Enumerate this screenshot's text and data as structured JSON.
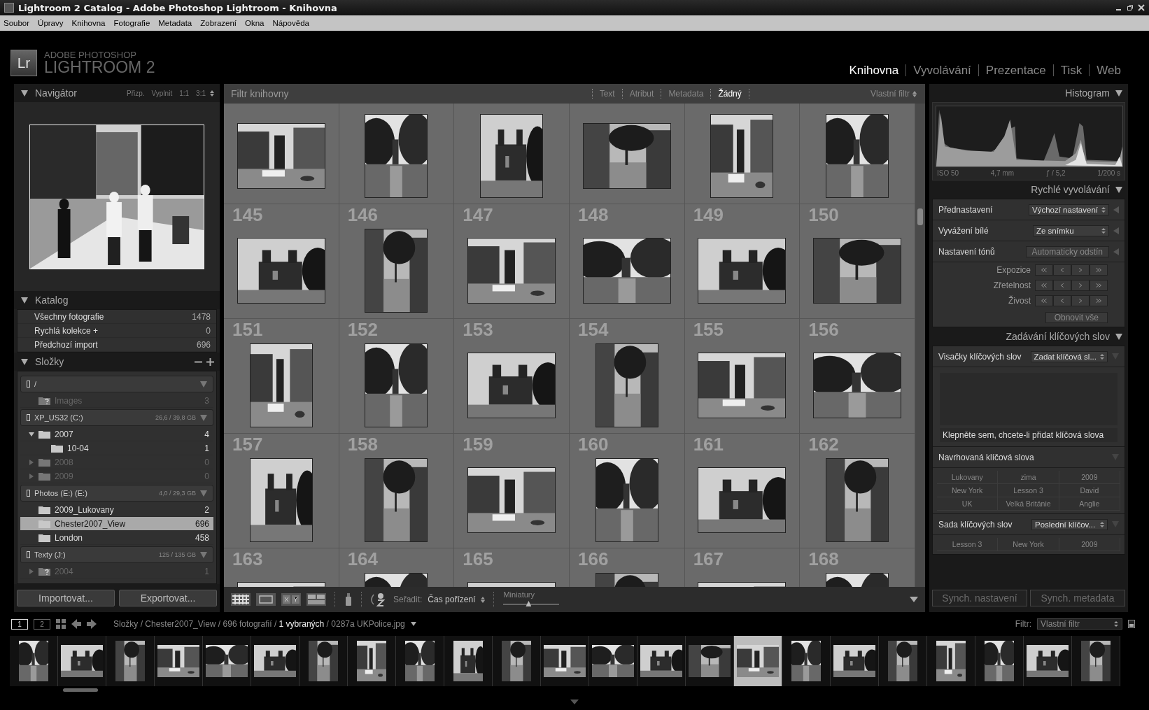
{
  "window": {
    "title": "Lightroom 2 Catalog - Adobe Photoshop Lightroom - Knihovna"
  },
  "menu": [
    "Soubor",
    "Úpravy",
    "Knihovna",
    "Fotografie",
    "Metadata",
    "Zobrazení",
    "Okna",
    "Nápověda"
  ],
  "brand": {
    "logo": "Lr",
    "line1": "ADOBE PHOTOSHOP",
    "line2": "LIGHTROOM 2"
  },
  "modules": [
    {
      "label": "Knihovna",
      "selected": true
    },
    {
      "label": "Vyvolávání",
      "selected": false
    },
    {
      "label": "Prezentace",
      "selected": false
    },
    {
      "label": "Tisk",
      "selected": false
    },
    {
      "label": "Web",
      "selected": false
    }
  ],
  "navigator": {
    "title": "Navigátor",
    "zoom_options": [
      "Přizp.",
      "Vyplnit",
      "1:1",
      "3:1"
    ]
  },
  "catalog": {
    "title": "Katalog",
    "items": [
      {
        "label": "Všechny fotografie",
        "count": "1478"
      },
      {
        "label": "Rychlá kolekce +",
        "count": "0"
      },
      {
        "label": "Předchozí import",
        "count": "696"
      }
    ]
  },
  "folders": {
    "title": "Složky",
    "volumes": [
      {
        "name": "/",
        "folders": [
          {
            "name": "Images",
            "count": "3",
            "available": false,
            "missing": true,
            "selected": false
          }
        ]
      },
      {
        "name": "XP_US32 (C:)",
        "usage": "26,6 / 39,8 GB",
        "folders": [
          {
            "name": "2007",
            "count": "4",
            "available": true,
            "missing": false,
            "selected": false,
            "expanded": true,
            "children": [
              {
                "name": "10-04",
                "count": "1",
                "available": true,
                "missing": false,
                "selected": false
              }
            ]
          },
          {
            "name": "2008",
            "count": "0",
            "available": false,
            "missing": false,
            "selected": false,
            "expanded": false
          },
          {
            "name": "2009",
            "count": "0",
            "available": false,
            "missing": false,
            "selected": false,
            "expanded": false
          }
        ]
      },
      {
        "name": "Photos (E:) (E:)",
        "usage": "4,0 / 29,3 GB",
        "folders": [
          {
            "name": "2009_Lukovany",
            "count": "2",
            "available": true,
            "missing": false,
            "selected": false
          },
          {
            "name": "Chester2007_View",
            "count": "696",
            "available": true,
            "missing": false,
            "selected": true
          },
          {
            "name": "London",
            "count": "458",
            "available": true,
            "missing": false,
            "selected": false
          }
        ]
      },
      {
        "name": "Texty (J:)",
        "usage": "125 / 135 GB",
        "folders": [
          {
            "name": "2004",
            "count": "1",
            "available": false,
            "missing": true,
            "selected": false,
            "expanded": false
          }
        ]
      }
    ]
  },
  "left_buttons": [
    "Importovat...",
    "Exportovat..."
  ],
  "filter_bar": {
    "title": "Filtr knihovny",
    "options": [
      {
        "label": "Text",
        "selected": false
      },
      {
        "label": "Atribut",
        "selected": false
      },
      {
        "label": "Metadata",
        "selected": false
      },
      {
        "label": "Žádný",
        "selected": true
      }
    ],
    "preset": "Vlastní filtr"
  },
  "grid": [
    {
      "portrait": false
    },
    {
      "portrait": true
    },
    {
      "portrait": true
    },
    {
      "portrait": false
    },
    {
      "portrait": true
    },
    {
      "portrait": true
    },
    {
      "number": "145",
      "portrait": false
    },
    {
      "number": "146",
      "portrait": true
    },
    {
      "number": "147",
      "portrait": false
    },
    {
      "number": "148",
      "portrait": false
    },
    {
      "number": "149",
      "portrait": false
    },
    {
      "number": "150",
      "portrait": false
    },
    {
      "number": "151",
      "portrait": true
    },
    {
      "number": "152",
      "portrait": true
    },
    {
      "number": "153",
      "portrait": false
    },
    {
      "number": "154",
      "portrait": true
    },
    {
      "number": "155",
      "portrait": false
    },
    {
      "number": "156",
      "portrait": false
    },
    {
      "number": "157",
      "portrait": true
    },
    {
      "number": "158",
      "portrait": true
    },
    {
      "number": "159",
      "portrait": false
    },
    {
      "number": "160",
      "portrait": true
    },
    {
      "number": "161",
      "portrait": false
    },
    {
      "number": "162",
      "portrait": true
    },
    {
      "number": "163",
      "portrait": false
    },
    {
      "number": "164",
      "portrait": true
    },
    {
      "number": "165",
      "portrait": false
    },
    {
      "number": "166",
      "portrait": true
    },
    {
      "number": "167",
      "portrait": false
    },
    {
      "number": "168",
      "portrait": true
    }
  ],
  "toolbar": {
    "sort_label": "Seřadit:",
    "sort_value": "Čas pořízení",
    "thumb_label": "Miniatury",
    "level": 0.45
  },
  "histogram": {
    "title": "Histogram",
    "exif": [
      "ISO 50",
      "4,7 mm",
      "ƒ / 5,2",
      "1/200 s"
    ]
  },
  "quick_develop": {
    "title": "Rychlé vyvolávání",
    "rows": [
      {
        "kind": "select",
        "label": "Přednastavení",
        "value": "Výchozí nastavení"
      },
      {
        "kind": "select",
        "label": "Vyvážení bílé",
        "value": "Ze snímku"
      },
      {
        "kind": "button",
        "label": "Nastavení tónů",
        "value": "Automaticky odstín"
      },
      {
        "kind": "stepper",
        "label": "Expozice"
      },
      {
        "kind": "stepper",
        "label": "Zřetelnost"
      },
      {
        "kind": "stepper",
        "label": "Živost"
      }
    ],
    "reset": "Obnovit vše"
  },
  "keywording": {
    "title": "Zadávání klíčových slov",
    "tags_label": "Visačky klíčových slov",
    "tags_select": "Zadat klíčová sl...",
    "placeholder": "Klepněte sem, chcete-li přidat klíčová slova",
    "suggested_title": "Navrhovaná klíčová slova",
    "suggested": [
      "Lukovany",
      "zima",
      "2009",
      "New York",
      "Lesson 3",
      "David",
      "UK",
      "Velká Británie",
      "Anglie"
    ],
    "set_label": "Sada klíčových slov",
    "set_select": "Poslední klíčov...",
    "set": [
      "Lesson 3",
      "New York",
      "2009"
    ]
  },
  "sync_buttons": [
    {
      "label": "Synch. nastavení",
      "disabled": true
    },
    {
      "label": "Synch. metadata",
      "disabled": true
    }
  ],
  "filmstrip_bar": {
    "screens": [
      {
        "label": "1",
        "selected": true
      },
      {
        "label": "2",
        "selected": false
      }
    ],
    "path": "Složky / Chester2007_View / 696 fotografií / **1 vybraných** / 0287a UKPolice.jpg",
    "filter_label": "Filtr:",
    "filter_value": "Vlastní filtr"
  },
  "filmstrip": [
    {
      "portrait": true,
      "selected": false
    },
    {
      "portrait": false,
      "selected": false
    },
    {
      "portrait": true,
      "selected": false
    },
    {
      "portrait": false,
      "selected": false
    },
    {
      "portrait": false,
      "selected": false
    },
    {
      "portrait": false,
      "selected": false
    },
    {
      "portrait": true,
      "selected": false
    },
    {
      "portrait": true,
      "selected": false
    },
    {
      "portrait": true,
      "selected": false
    },
    {
      "portrait": true,
      "selected": false
    },
    {
      "portrait": true,
      "selected": false
    },
    {
      "portrait": false,
      "selected": false
    },
    {
      "portrait": false,
      "selected": false
    },
    {
      "portrait": false,
      "selected": false
    },
    {
      "portrait": false,
      "selected": false
    },
    {
      "portrait": false,
      "selected": true
    },
    {
      "portrait": true,
      "selected": false
    },
    {
      "portrait": false,
      "selected": false
    },
    {
      "portrait": true,
      "selected": false
    },
    {
      "portrait": true,
      "selected": false
    },
    {
      "portrait": true,
      "selected": false
    },
    {
      "portrait": false,
      "selected": false
    },
    {
      "portrait": true,
      "selected": false
    }
  ]
}
